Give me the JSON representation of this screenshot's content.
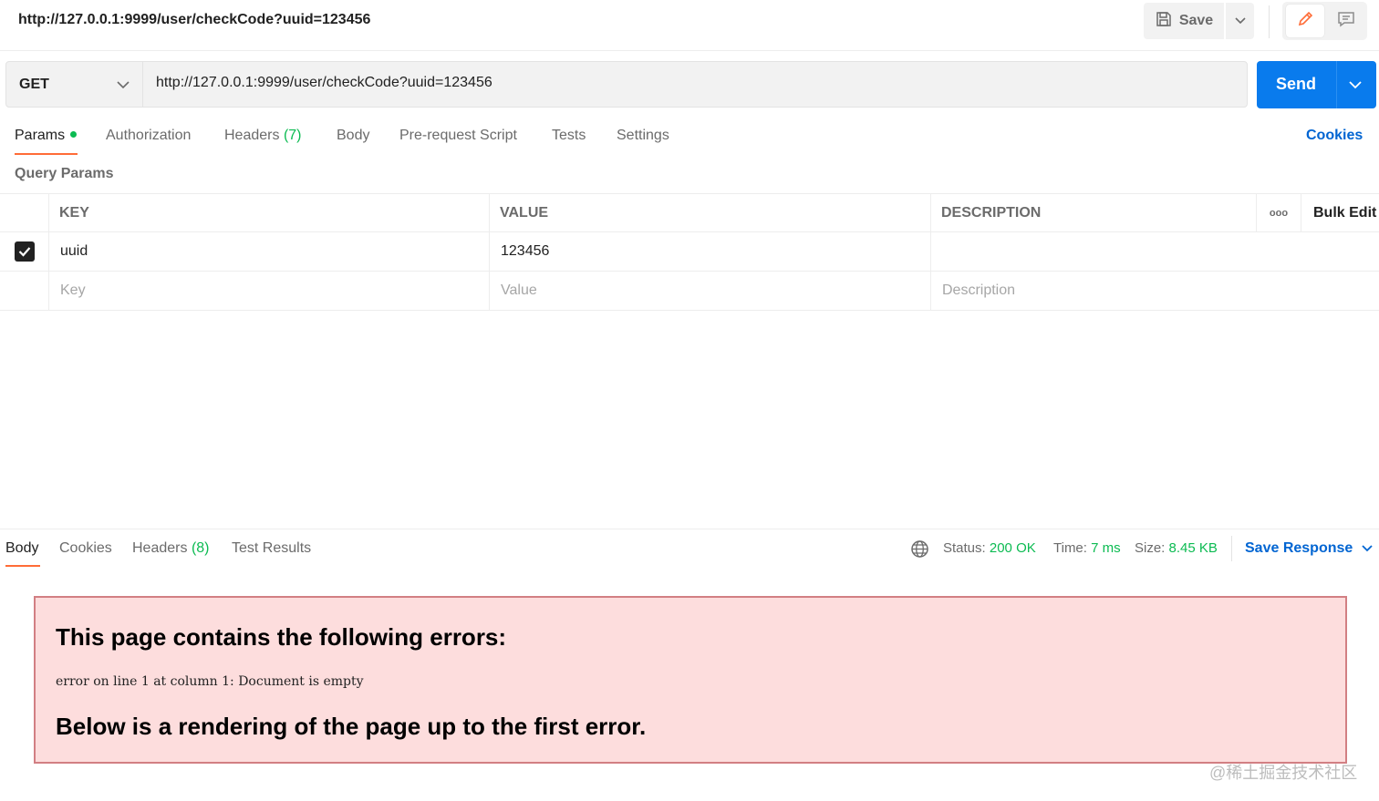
{
  "request": {
    "title": "http://127.0.0.1:9999/user/checkCode?uuid=123456",
    "save_label": "Save",
    "method": "GET",
    "url": "http://127.0.0.1:9999/user/checkCode?uuid=123456",
    "send_label": "Send"
  },
  "request_tabs": [
    {
      "label": "Params"
    },
    {
      "label": "Authorization"
    },
    {
      "label": "Headers",
      "count": "(7)"
    },
    {
      "label": "Body"
    },
    {
      "label": "Pre-request Script"
    },
    {
      "label": "Tests"
    },
    {
      "label": "Settings"
    }
  ],
  "cookies_label": "Cookies",
  "query_params": {
    "title": "Query Params",
    "headers": {
      "key": "KEY",
      "value": "VALUE",
      "description": "DESCRIPTION",
      "bulk_edit": "Bulk Edit",
      "more": "ooo"
    },
    "rows": [
      {
        "checked": true,
        "key": "uuid",
        "value": "123456",
        "description": ""
      }
    ],
    "placeholders": {
      "key": "Key",
      "value": "Value",
      "description": "Description"
    }
  },
  "response": {
    "tabs": [
      {
        "label": "Body"
      },
      {
        "label": "Cookies"
      },
      {
        "label": "Headers",
        "count": "(8)"
      },
      {
        "label": "Test Results"
      }
    ],
    "status_label": "Status:",
    "status_value": "200 OK",
    "time_label": "Time:",
    "time_value": "7 ms",
    "size_label": "Size:",
    "size_value": "8.45 KB",
    "save_response": "Save Response"
  },
  "error": {
    "heading": "This page contains the following errors:",
    "detail": "error on line 1 at column 1: Document is empty",
    "footer": "Below is a rendering of the page up to the first error."
  },
  "watermark": "@稀土掘金技术社区",
  "colors": {
    "accent": "#ff6c37",
    "send": "#097bed",
    "link": "#0265d2",
    "ok": "#0cbb52",
    "error_bg": "#fddddd",
    "error_border": "#d27f83"
  }
}
